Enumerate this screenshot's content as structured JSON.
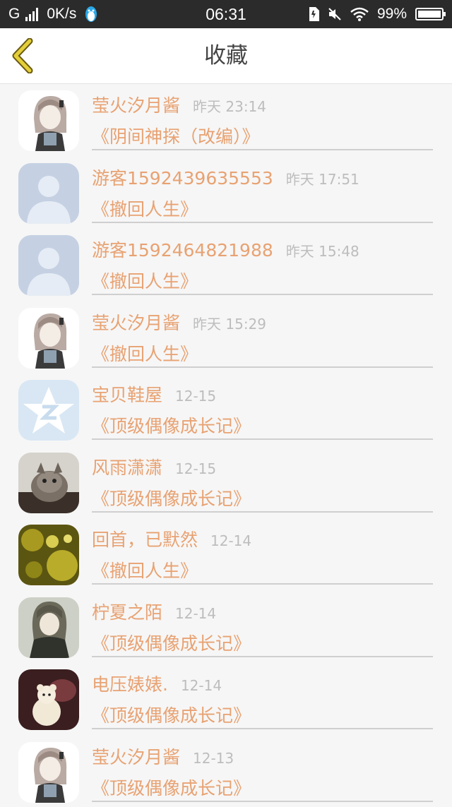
{
  "status_bar": {
    "network": "G",
    "speed": "0K/s",
    "time": "06:31",
    "battery": "99%",
    "battery_level": 0.99
  },
  "header": {
    "title": "收藏",
    "back_icon": "chevron-left-icon"
  },
  "colors": {
    "accent": "#e8a272",
    "meta": "#bdbdbd",
    "back_icon": "#d9c43a"
  },
  "favorites": [
    {
      "name": "莹火汐月酱",
      "time": "昨天 23:14",
      "book": "《阴间神探（改编）》",
      "avatar": "anime-girl"
    },
    {
      "name": "游客1592439635553",
      "time": "昨天 17:51",
      "book": "《撤回人生》",
      "avatar": "default-user"
    },
    {
      "name": "游客1592464821988",
      "time": "昨天 15:48",
      "book": "《撤回人生》",
      "avatar": "default-user"
    },
    {
      "name": "莹火汐月酱",
      "time": "昨天 15:29",
      "book": "《撤回人生》",
      "avatar": "anime-girl"
    },
    {
      "name": "宝贝鞋屋",
      "time": "12-15",
      "book": "《顶级偶像成长记》",
      "avatar": "qzone-star"
    },
    {
      "name": "风雨潇潇",
      "time": "12-15",
      "book": "《顶级偶像成长记》",
      "avatar": "cat-photo"
    },
    {
      "name": "回首，已默然",
      "time": "12-14",
      "book": "《撤回人生》",
      "avatar": "golden-bokeh"
    },
    {
      "name": "柠夏之陌",
      "time": "12-14",
      "book": "《顶级偶像成长记》",
      "avatar": "anime-girl-dark"
    },
    {
      "name": "电压婊婊.",
      "time": "12-14",
      "book": "《顶级偶像成长记》",
      "avatar": "plush-toy"
    },
    {
      "name": "莹火汐月酱",
      "time": "12-13",
      "book": "《顶级偶像成长记》",
      "avatar": "anime-girl"
    }
  ]
}
